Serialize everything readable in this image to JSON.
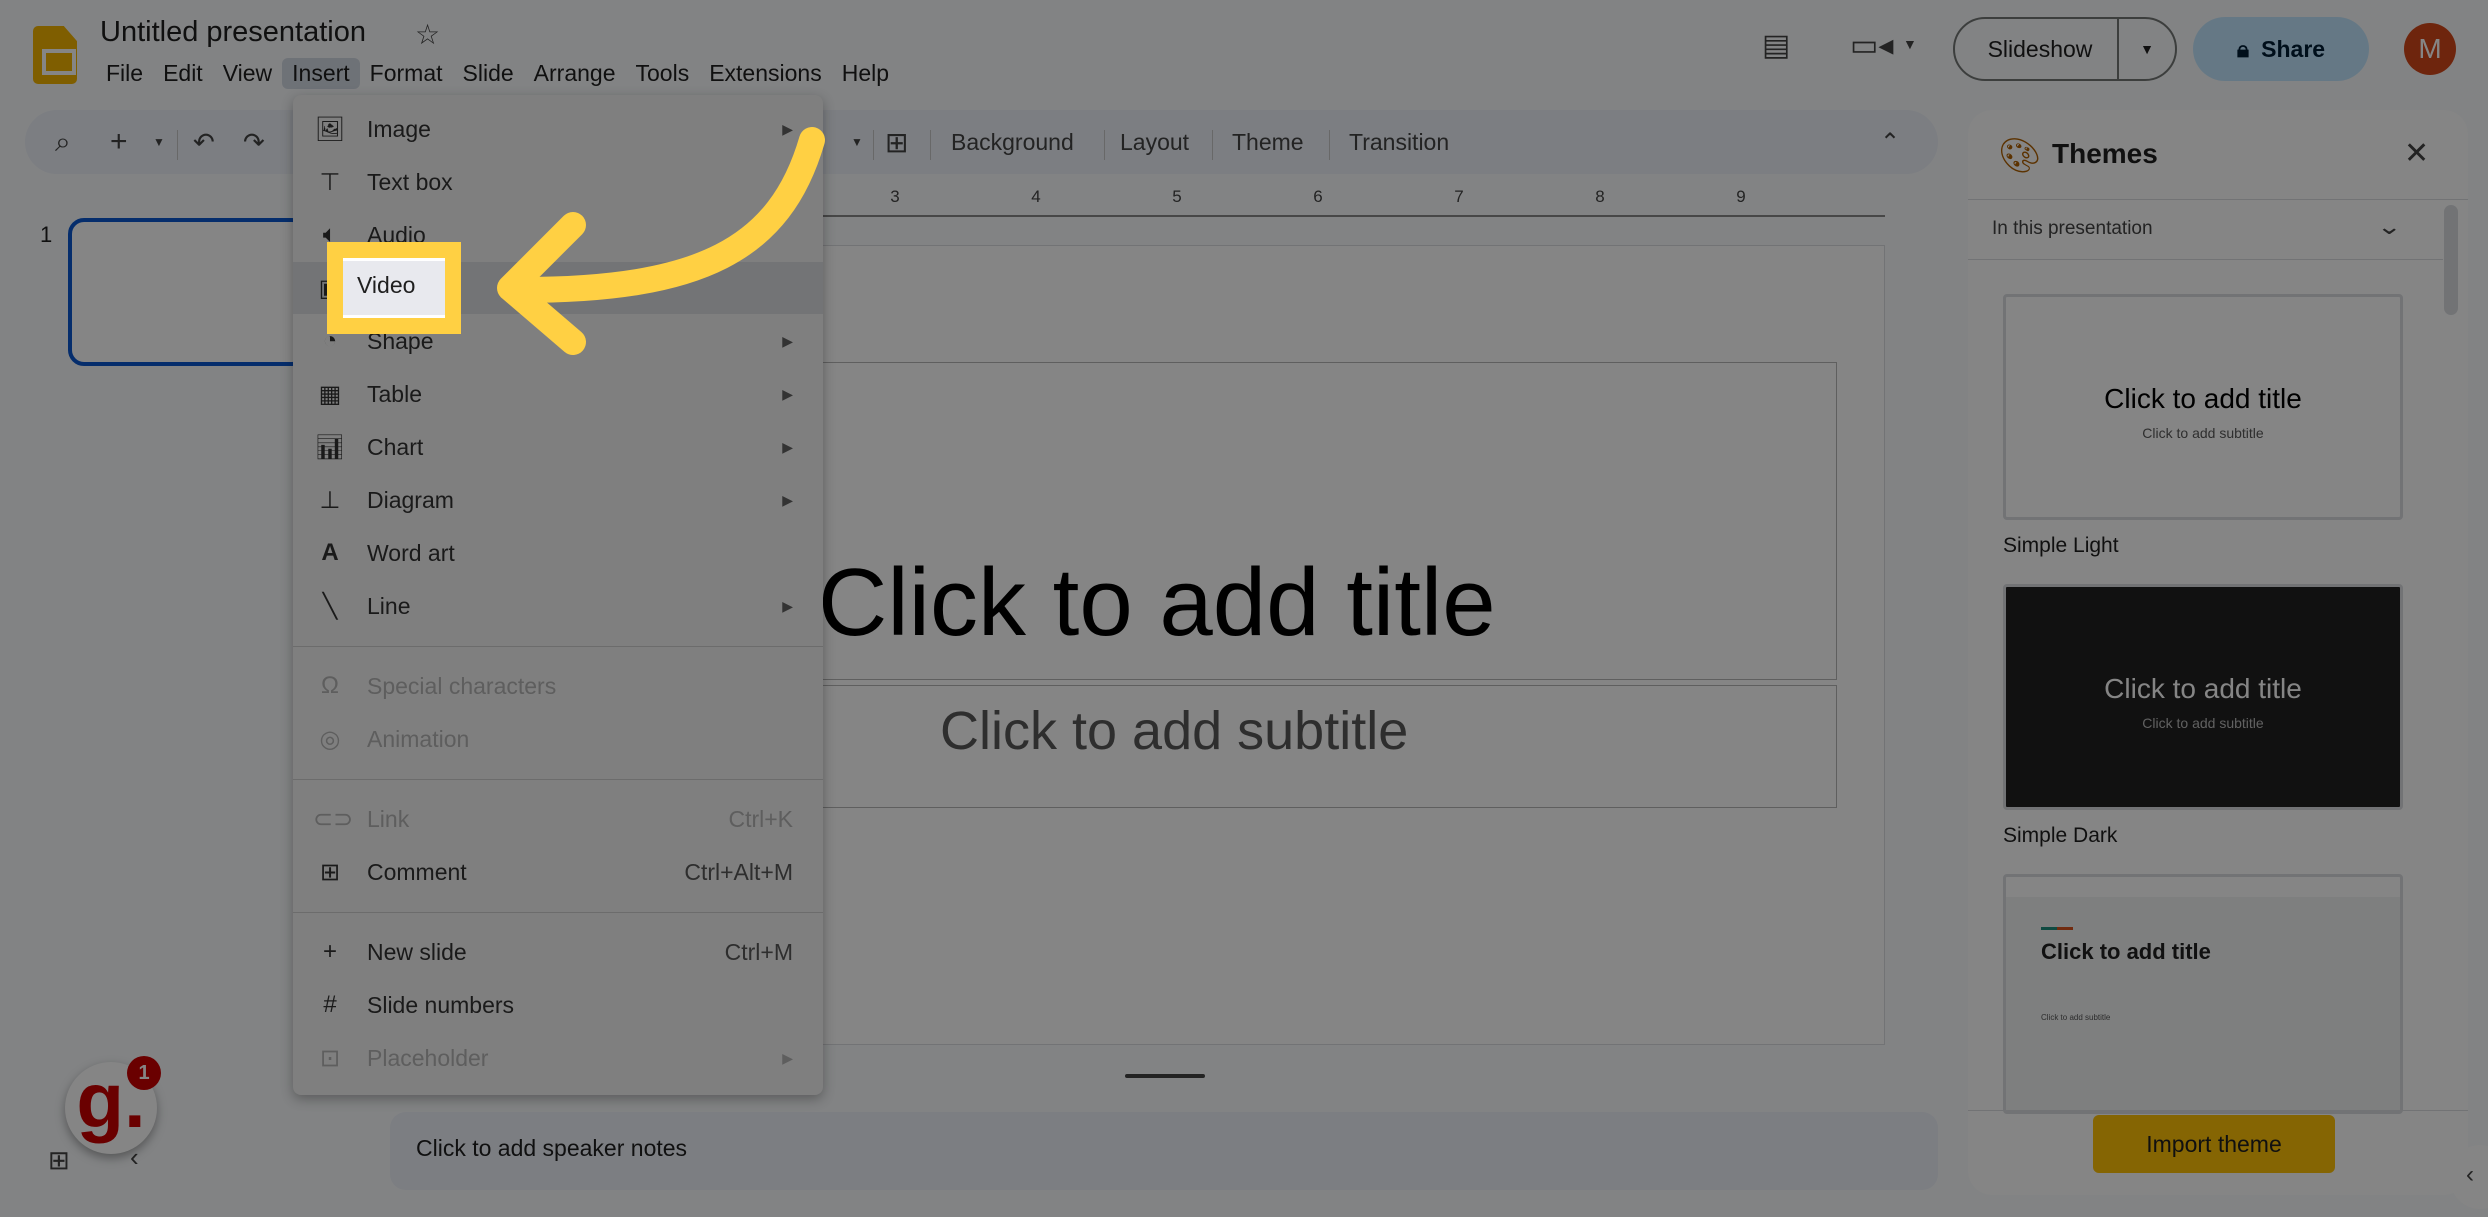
{
  "app": {
    "doc_title": "Untitled presentation",
    "menus": [
      "File",
      "Edit",
      "View",
      "Insert",
      "Format",
      "Slide",
      "Arrange",
      "Tools",
      "Extensions",
      "Help"
    ],
    "active_menu": "Insert",
    "slideshow_label": "Slideshow",
    "share_label": "Share",
    "avatar_initial": "M"
  },
  "toolbar": {
    "buttons": [
      "Background",
      "Layout",
      "Theme",
      "Transition"
    ]
  },
  "ruler": {
    "numbers": [
      "3",
      "4",
      "5",
      "6",
      "7",
      "8",
      "9"
    ]
  },
  "filmstrip": {
    "slide_number": "1"
  },
  "slide": {
    "title_placeholder": "Click to add title",
    "subtitle_placeholder": "Click to add subtitle"
  },
  "notes": {
    "placeholder": "Click to add speaker notes"
  },
  "themes_panel": {
    "title": "Themes",
    "filter": "In this presentation",
    "themes": [
      {
        "name": "Simple Light",
        "title": "Click to add title",
        "subtitle": "Click to add subtitle"
      },
      {
        "name": "Simple Dark",
        "title": "Click to add title",
        "subtitle": "Click to add subtitle"
      },
      {
        "name": "",
        "title": "Click to add title",
        "subtitle": "Click to add subtitle"
      }
    ],
    "import_label": "Import theme"
  },
  "guide_widget": {
    "letter": "g.",
    "badge_count": "1"
  },
  "insert_menu": {
    "items": [
      {
        "label": "Image",
        "icon": "image-icon",
        "submenu": true,
        "disabled": false
      },
      {
        "label": "Text box",
        "icon": "text-box-icon",
        "submenu": false,
        "disabled": false
      },
      {
        "label": "Audio",
        "icon": "audio-icon",
        "submenu": false,
        "disabled": false
      },
      {
        "label": "Video",
        "icon": "video-icon",
        "submenu": false,
        "disabled": false,
        "highlighted": true
      },
      {
        "label": "Shape",
        "icon": "shape-icon",
        "submenu": true,
        "disabled": false
      },
      {
        "label": "Table",
        "icon": "table-icon",
        "submenu": true,
        "disabled": false
      },
      {
        "label": "Chart",
        "icon": "chart-icon",
        "submenu": true,
        "disabled": false
      },
      {
        "label": "Diagram",
        "icon": "diagram-icon",
        "submenu": true,
        "disabled": false
      },
      {
        "label": "Word art",
        "icon": "word-art-icon",
        "submenu": false,
        "disabled": false
      },
      {
        "label": "Line",
        "icon": "line-icon",
        "submenu": true,
        "disabled": false
      },
      {
        "label": "Special characters",
        "icon": "omega-icon",
        "submenu": false,
        "disabled": true
      },
      {
        "label": "Animation",
        "icon": "animation-icon",
        "submenu": false,
        "disabled": true
      },
      {
        "label": "Link",
        "icon": "link-icon",
        "shortcut": "Ctrl+K",
        "submenu": false,
        "disabled": true
      },
      {
        "label": "Comment",
        "icon": "add-comment-icon",
        "shortcut": "Ctrl+Alt+M",
        "submenu": false,
        "disabled": false
      },
      {
        "label": "New slide",
        "icon": "plus-icon",
        "shortcut": "Ctrl+M",
        "submenu": false,
        "disabled": false
      },
      {
        "label": "Slide numbers",
        "icon": "hash-icon",
        "submenu": false,
        "disabled": false
      },
      {
        "label": "Placeholder",
        "icon": "placeholder-icon",
        "submenu": true,
        "disabled": true
      }
    ]
  },
  "annotation": {
    "highlight_label": "Video",
    "accent_color": "#ffd043"
  }
}
